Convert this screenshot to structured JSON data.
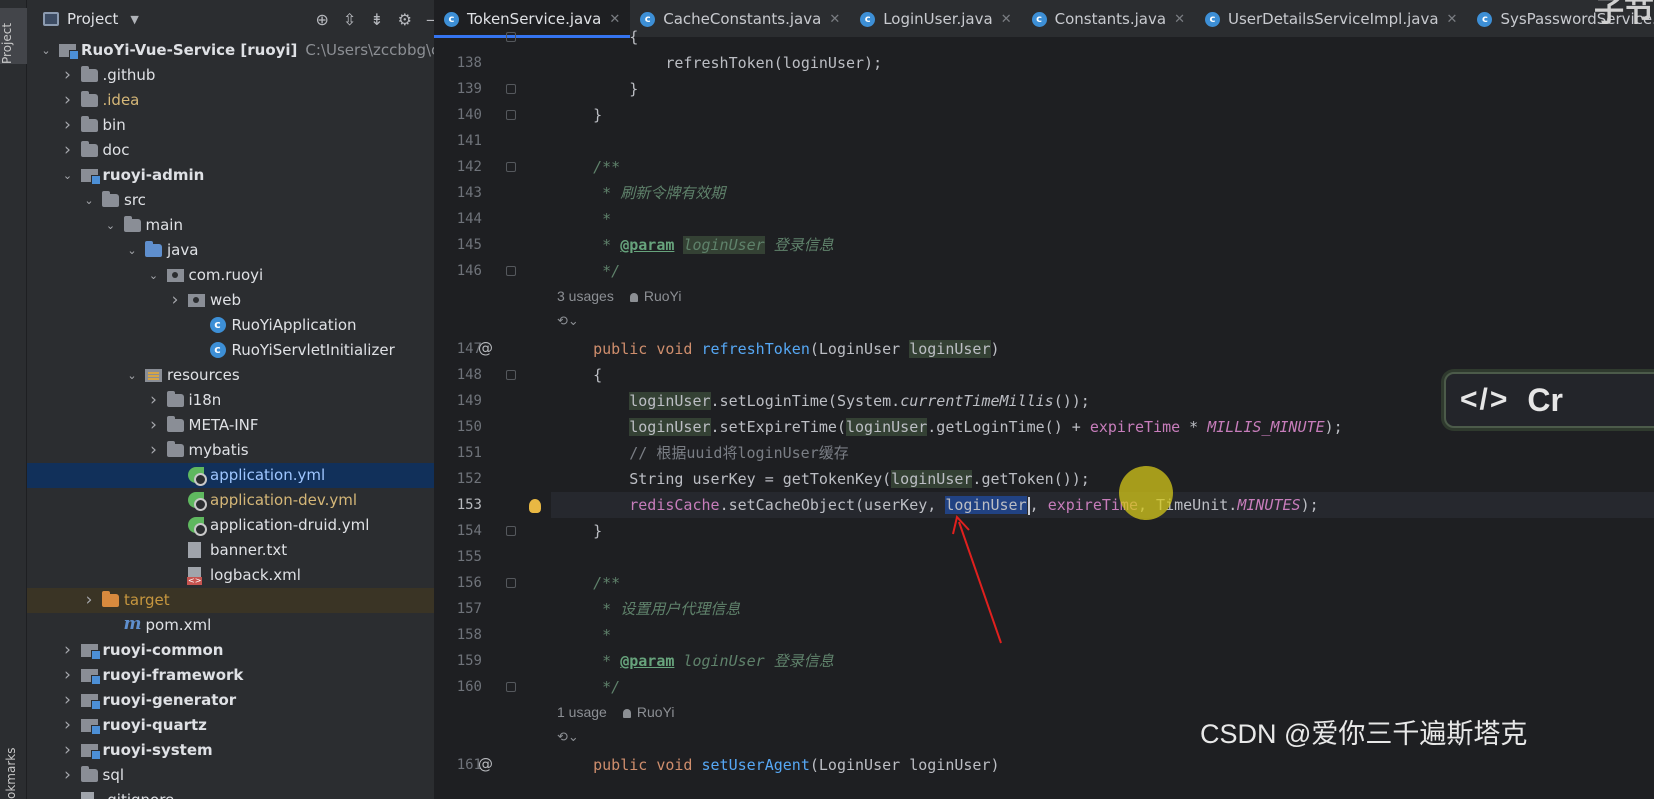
{
  "toolstrip": {
    "project_label": "Project",
    "bookmarks_label": "okmarks"
  },
  "project_panel": {
    "title": "Project",
    "tree": [
      {
        "label": "RuoYi-Vue-Service [ruoyi]",
        "path": "C:\\Users\\zccbbg\\code\\g",
        "depth": 0,
        "icon": "module",
        "expanded": true,
        "bold": true
      },
      {
        "label": ".github",
        "depth": 1,
        "icon": "folder",
        "expanded": false
      },
      {
        "label": ".idea",
        "depth": 1,
        "icon": "folder",
        "expanded": false,
        "color": "yellow"
      },
      {
        "label": "bin",
        "depth": 1,
        "icon": "folder",
        "expanded": false
      },
      {
        "label": "doc",
        "depth": 1,
        "icon": "folder",
        "expanded": false
      },
      {
        "label": "ruoyi-admin",
        "depth": 1,
        "icon": "module",
        "expanded": true,
        "bold": true
      },
      {
        "label": "src",
        "depth": 2,
        "icon": "folder",
        "expanded": true
      },
      {
        "label": "main",
        "depth": 3,
        "icon": "folder",
        "expanded": true
      },
      {
        "label": "java",
        "depth": 4,
        "icon": "folder-blue",
        "expanded": true
      },
      {
        "label": "com.ruoyi",
        "depth": 5,
        "icon": "package",
        "expanded": true
      },
      {
        "label": "web",
        "depth": 6,
        "icon": "package",
        "expanded": false
      },
      {
        "label": "RuoYiApplication",
        "depth": 7,
        "icon": "class"
      },
      {
        "label": "RuoYiServletInitializer",
        "depth": 7,
        "icon": "class"
      },
      {
        "label": "resources",
        "depth": 4,
        "icon": "resources",
        "expanded": true
      },
      {
        "label": "i18n",
        "depth": 5,
        "icon": "folder",
        "expanded": false
      },
      {
        "label": "META-INF",
        "depth": 5,
        "icon": "folder",
        "expanded": false
      },
      {
        "label": "mybatis",
        "depth": 5,
        "icon": "folder",
        "expanded": false
      },
      {
        "label": "application.yml",
        "depth": 6,
        "icon": "yml",
        "selected": true,
        "color": "blue"
      },
      {
        "label": "application-dev.yml",
        "depth": 6,
        "icon": "yml",
        "color": "yellow"
      },
      {
        "label": "application-druid.yml",
        "depth": 6,
        "icon": "yml"
      },
      {
        "label": "banner.txt",
        "depth": 6,
        "icon": "txt"
      },
      {
        "label": "logback.xml",
        "depth": 6,
        "icon": "xml"
      },
      {
        "label": "target",
        "depth": 2,
        "icon": "folder-orange",
        "expanded": false,
        "color": "orange",
        "highlight": true
      },
      {
        "label": "pom.xml",
        "depth": 3,
        "icon": "maven"
      },
      {
        "label": "ruoyi-common",
        "depth": 1,
        "icon": "module",
        "expanded": false,
        "bold": true
      },
      {
        "label": "ruoyi-framework",
        "depth": 1,
        "icon": "module",
        "expanded": false,
        "bold": true
      },
      {
        "label": "ruoyi-generator",
        "depth": 1,
        "icon": "module",
        "expanded": false,
        "bold": true
      },
      {
        "label": "ruoyi-quartz",
        "depth": 1,
        "icon": "module",
        "expanded": false,
        "bold": true
      },
      {
        "label": "ruoyi-system",
        "depth": 1,
        "icon": "module",
        "expanded": false,
        "bold": true
      },
      {
        "label": "sql",
        "depth": 1,
        "icon": "folder",
        "expanded": false
      },
      {
        "label": ".gitignore",
        "depth": 1,
        "icon": "txt"
      }
    ]
  },
  "tabs": [
    {
      "label": "TokenService.java",
      "active": true
    },
    {
      "label": "CacheConstants.java"
    },
    {
      "label": "LoginUser.java"
    },
    {
      "label": "Constants.java"
    },
    {
      "label": "UserDetailsServiceImpl.java"
    },
    {
      "label": "SysPasswordService.java"
    }
  ],
  "editor": {
    "current_line": "153",
    "lines": [
      {
        "n": "",
        "fold": true,
        "tokens": [
          [
            "        {",
            ""
          ]
        ]
      },
      {
        "n": "138",
        "tokens": [
          [
            "            refreshToken(loginUser);",
            ""
          ]
        ]
      },
      {
        "n": "139",
        "fold": true,
        "tokens": [
          [
            "        }",
            ""
          ]
        ]
      },
      {
        "n": "140",
        "fold": true,
        "tokens": [
          [
            "    }",
            ""
          ]
        ]
      },
      {
        "n": "141",
        "tokens": []
      },
      {
        "n": "142",
        "fold": true,
        "tokens": [
          [
            "    /**",
            "dc"
          ]
        ]
      },
      {
        "n": "143",
        "tokens": [
          [
            "     * 刷新令牌有效期",
            "dc"
          ]
        ]
      },
      {
        "n": "144",
        "tokens": [
          [
            "     *",
            "dc"
          ]
        ]
      },
      {
        "n": "145",
        "tokens": [
          [
            "     * ",
            "dc"
          ],
          [
            "@param",
            "dtag"
          ],
          [
            " ",
            "dc"
          ],
          [
            "loginUser",
            "dc pbox"
          ],
          [
            " 登录信息",
            "dc"
          ]
        ]
      },
      {
        "n": "146",
        "fold": true,
        "tokens": [
          [
            "     */",
            "dc"
          ]
        ]
      },
      {
        "inlay": true,
        "usages": "3 usages",
        "author": "RuoYi"
      },
      {
        "hint": true
      },
      {
        "n": "147",
        "at": true,
        "tokens": [
          [
            "    ",
            ""
          ],
          [
            "public",
            "kw"
          ],
          [
            " ",
            ""
          ],
          [
            "void",
            "kw"
          ],
          [
            " ",
            ""
          ],
          [
            "refreshToken",
            "fn"
          ],
          [
            "(LoginUser ",
            ""
          ],
          [
            "loginUser",
            "pbox"
          ],
          [
            ")",
            ""
          ]
        ]
      },
      {
        "n": "148",
        "fold": true,
        "tokens": [
          [
            "    {",
            ""
          ]
        ]
      },
      {
        "n": "149",
        "tokens": [
          [
            "        ",
            ""
          ],
          [
            "loginUser",
            "pbox"
          ],
          [
            ".setLoginTime(System.",
            ""
          ],
          [
            "currentTimeMillis",
            "st"
          ],
          [
            "());",
            ""
          ]
        ]
      },
      {
        "n": "150",
        "tokens": [
          [
            "        ",
            ""
          ],
          [
            "loginUser",
            "pbox"
          ],
          [
            ".setExpireTime(",
            ""
          ],
          [
            "loginUser",
            "pbox"
          ],
          [
            ".getLoginTime() + ",
            ""
          ],
          [
            "expireTime",
            "fld"
          ],
          [
            " * ",
            ""
          ],
          [
            "MILLIS_MINUTE",
            "cst"
          ],
          [
            ");",
            ""
          ]
        ]
      },
      {
        "n": "151",
        "tokens": [
          [
            "        // 根据uuid将loginUser缓存",
            "cm"
          ]
        ]
      },
      {
        "n": "152",
        "tokens": [
          [
            "        String userKey = getTokenKey(",
            ""
          ],
          [
            "loginUser",
            "pbox"
          ],
          [
            ".getToken());",
            ""
          ]
        ]
      },
      {
        "n": "153",
        "bulb": true,
        "tokens": [
          [
            "        ",
            ""
          ],
          [
            "redisCache",
            "fld"
          ],
          [
            ".setCacheObject(userKey, ",
            ""
          ],
          [
            "loginUser",
            "hl"
          ],
          [
            "|",
            "cursor"
          ],
          [
            ", ",
            ""
          ],
          [
            "expireTime",
            "fld"
          ],
          [
            ", TimeUnit.",
            ""
          ],
          [
            "MINUTES",
            "cst"
          ],
          [
            ");",
            ""
          ]
        ]
      },
      {
        "n": "154",
        "fold": true,
        "tokens": [
          [
            "    }",
            ""
          ]
        ]
      },
      {
        "n": "155",
        "tokens": []
      },
      {
        "n": "156",
        "fold": true,
        "tokens": [
          [
            "    /**",
            "dc"
          ]
        ]
      },
      {
        "n": "157",
        "tokens": [
          [
            "     * 设置用户代理信息",
            "dc"
          ]
        ]
      },
      {
        "n": "158",
        "tokens": [
          [
            "     *",
            "dc"
          ]
        ]
      },
      {
        "n": "159",
        "tokens": [
          [
            "     * ",
            "dc"
          ],
          [
            "@param",
            "dtag"
          ],
          [
            " loginUser 登录信息",
            "dc"
          ]
        ]
      },
      {
        "n": "160",
        "fold": true,
        "tokens": [
          [
            "     */",
            "dc"
          ]
        ]
      },
      {
        "inlay": true,
        "usages": "1 usage",
        "author": "RuoYi"
      },
      {
        "hint": true
      },
      {
        "n": "161",
        "at": true,
        "tokens": [
          [
            "    ",
            ""
          ],
          [
            "public",
            "kw"
          ],
          [
            " ",
            ""
          ],
          [
            "void",
            "kw"
          ],
          [
            " ",
            ""
          ],
          [
            "setUserAgent",
            "fn"
          ],
          [
            "(LoginUser loginUser)",
            ""
          ]
        ]
      }
    ]
  },
  "overlay": {
    "code_badge_text": "Cr",
    "code_badge_icon": "code-brackets-icon",
    "watermark": "CSDN @爱你三千遍斯塔克",
    "watermark_top": "子节",
    "annotation_arrow_color": "#e0201e",
    "hover_circle_color": "#d4c71a"
  }
}
